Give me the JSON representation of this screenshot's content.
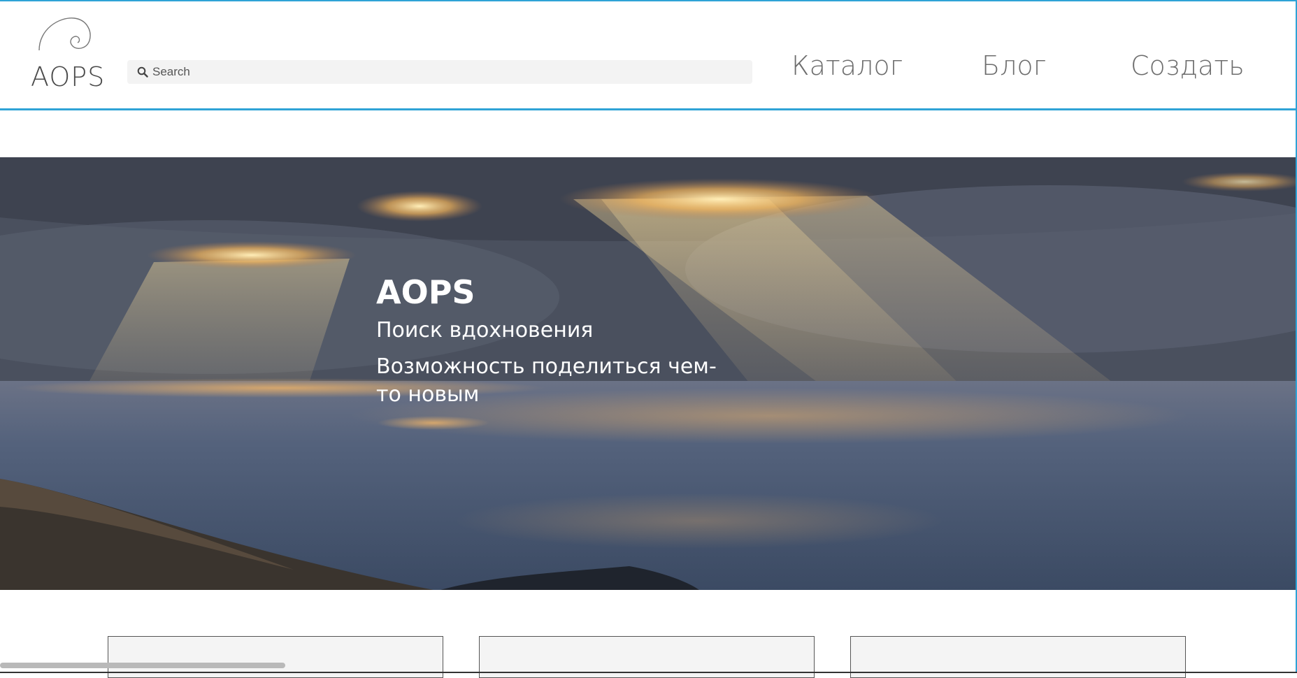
{
  "header": {
    "logo_text": "AOPS",
    "search": {
      "placeholder": "Search",
      "value": ""
    },
    "nav": [
      {
        "label": "Каталог"
      },
      {
        "label": "Блог"
      },
      {
        "label": "Создать"
      }
    ]
  },
  "hero": {
    "title": "AOPS",
    "subtitle": "Поиск вдохновения",
    "description": "Возможность поделиться чем-то новым"
  },
  "cards": [
    {},
    {},
    {}
  ],
  "colors": {
    "accent_border": "#2fa3d6",
    "nav_text": "#6d6d6d",
    "hero_text": "#ffffff"
  },
  "scrollbar": {
    "horizontal_visible_fraction": 0.22
  }
}
